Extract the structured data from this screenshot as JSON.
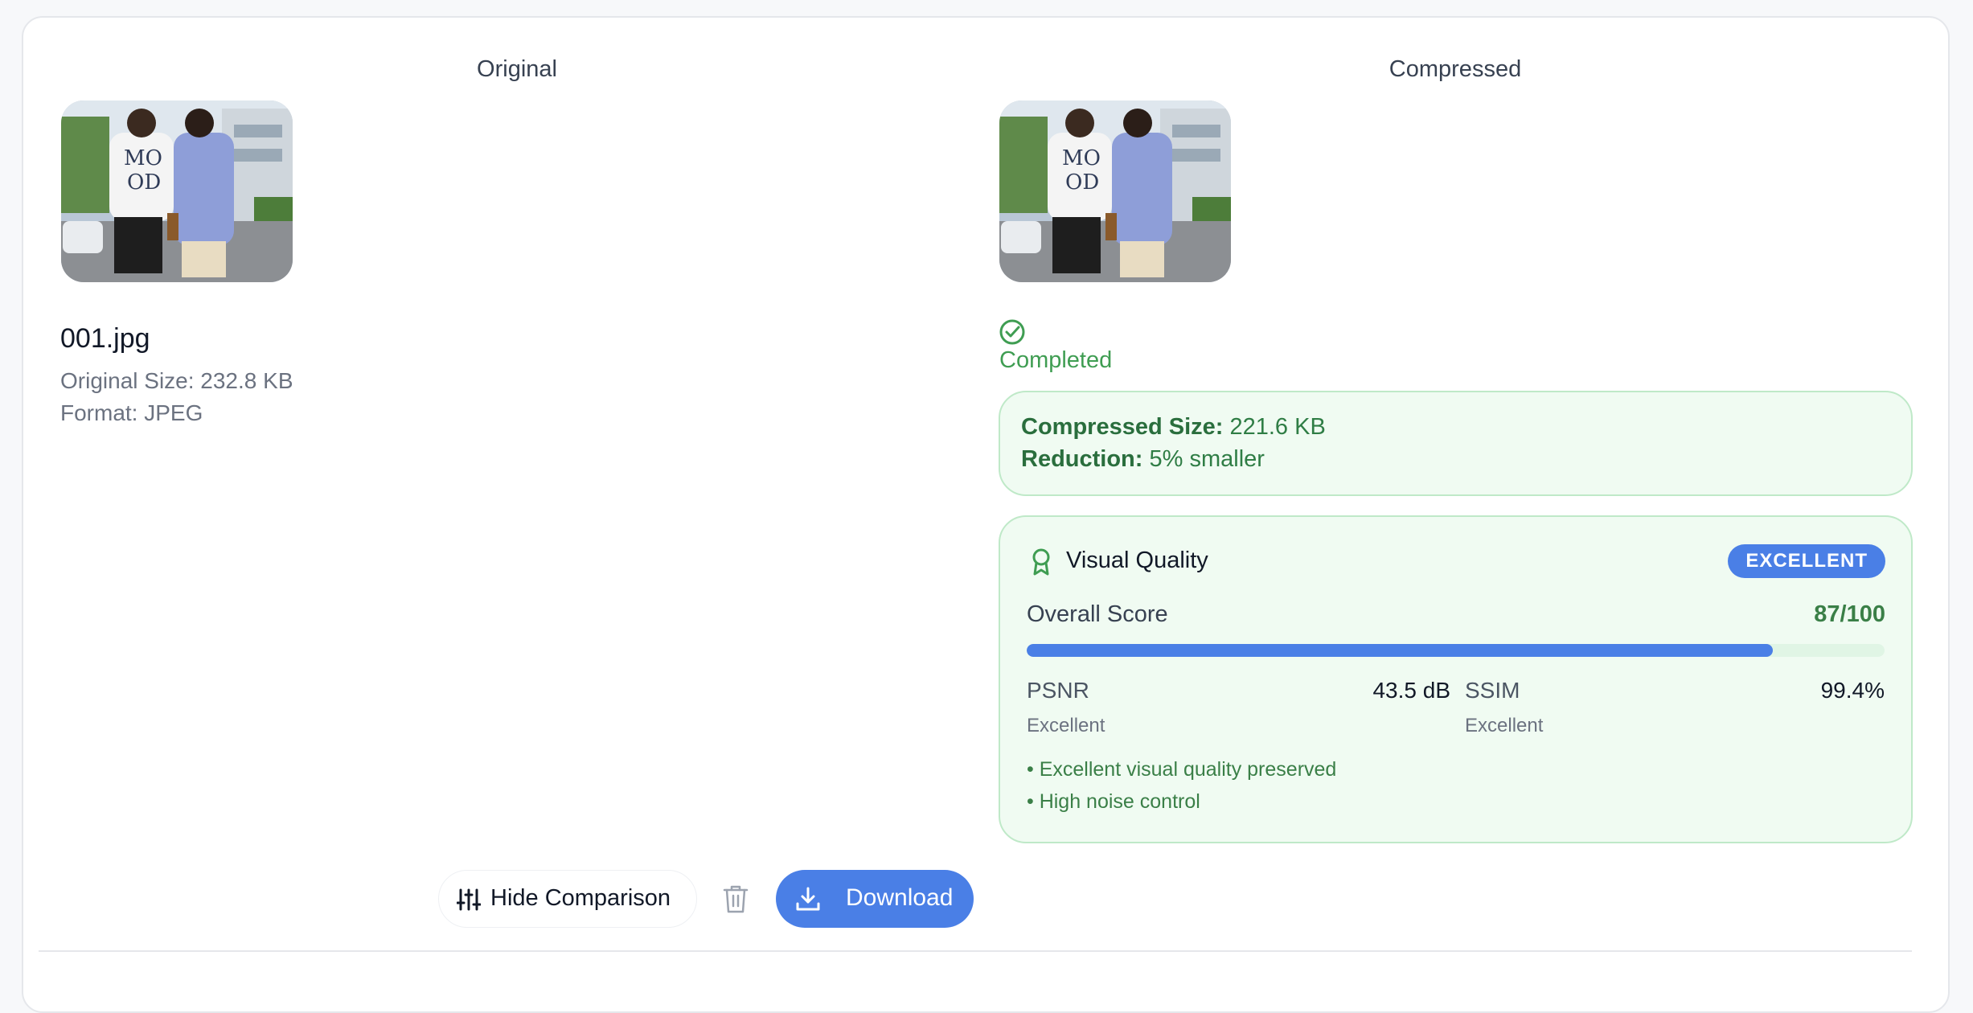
{
  "original": {
    "title": "Original",
    "filename": "001.jpg",
    "size_label": "Original Size: 232.8 KB",
    "format_label": "Format: JPEG"
  },
  "compressed": {
    "title": "Compressed",
    "status": "Completed",
    "compressed_size_key": "Compressed Size:",
    "compressed_size_value": "221.6 KB",
    "reduction_key": "Reduction:",
    "reduction_value": "5% smaller"
  },
  "quality": {
    "title": "Visual Quality",
    "badge": "EXCELLENT",
    "overall_label": "Overall Score",
    "overall_value": "87/100",
    "overall_fraction": 0.87,
    "psnr_label": "PSNR",
    "psnr_value": "43.5 dB",
    "psnr_rating": "Excellent",
    "ssim_label": "SSIM",
    "ssim_value": "99.4%",
    "ssim_rating": "Excellent",
    "notes": [
      "• Excellent visual quality preserved",
      "• High noise control"
    ]
  },
  "actions": {
    "hide_comparison": "Hide Comparison",
    "download": "Download"
  },
  "colors": {
    "accent": "#4a7fe6",
    "success": "#3f9d52",
    "success_bg": "#f0fbf2"
  },
  "icons": {
    "status": "check-circle-icon",
    "quality": "award-icon",
    "hide": "sliders-icon",
    "delete": "trash-icon",
    "download": "download-icon"
  }
}
